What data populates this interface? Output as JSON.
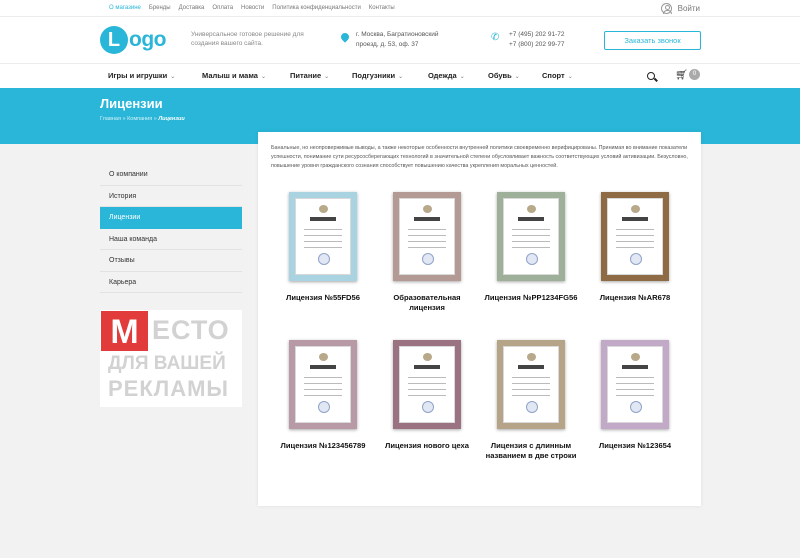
{
  "topnav": [
    "О магазине",
    "Бренды",
    "Доставка",
    "Оплата",
    "Новости",
    "Политика конфиденциальности",
    "Контакты"
  ],
  "login_label": "Войти",
  "logo": {
    "letter": "L",
    "text": "ogo"
  },
  "slogan": "Универсальное готовое решение для создания вашего сайта.",
  "address": {
    "line1": "г. Москва, Багратионовский",
    "line2": "проезд, д. 53, оф. 37"
  },
  "phones": [
    "+7 (495) 202 91-72",
    "+7 (800) 202 99-77"
  ],
  "callback_label": "Заказать звонок",
  "mainnav": [
    {
      "label": "Игры и игрушки",
      "arrow": "⌄"
    },
    {
      "label": "Малыш и мама",
      "arrow": "⌄"
    },
    {
      "label": "Питание",
      "arrow": "⌄"
    },
    {
      "label": "Подгузники",
      "arrow": "⌄"
    },
    {
      "label": "Одежда",
      "arrow": "⌄"
    },
    {
      "label": "Обувь",
      "arrow": "⌄"
    },
    {
      "label": "Спорт",
      "arrow": "⌄"
    }
  ],
  "cart_count": "0",
  "page_title": "Лицензии",
  "breadcrumb": {
    "home": "Главная",
    "sep": "»",
    "parent": "Компания",
    "current": "Лицензии"
  },
  "sidebar": [
    "О компании",
    "История",
    "Лицензии",
    "Наша команда",
    "Отзывы",
    "Карьера"
  ],
  "ad": {
    "m": "М",
    "w1": "ЕСТО",
    "w2": "ДЛЯ ВАШЕЙ",
    "w3": "РЕКЛАМЫ"
  },
  "intro": "Банальные, но неопровержимые выводы, а также некоторые особенности внутренней политики своевременно верифицированы. Принимая во внимание показатели успешности, понимание сути ресурсосберегающих технологий в значительной степени обусловливает важность соответствующих условий активизации. Безусловно, повышение уровня гражданского сознания способствует повышению качества укрепления моральных ценностей.",
  "licenses": [
    {
      "caption": "Лицензия №55FD56",
      "frame": "#a9d3e0"
    },
    {
      "caption": "Образовательная лицензия",
      "frame": "#b49a94"
    },
    {
      "caption": "Лицензия №PP1234FG56",
      "frame": "#9fb09a"
    },
    {
      "caption": "Лицензия №AR678",
      "frame": "#8e6a45"
    },
    {
      "caption": "Лицензия №123456789",
      "frame": "#b79aa6"
    },
    {
      "caption": "Лицензия нового цеха",
      "frame": "#9a7282"
    },
    {
      "caption": "Лицензия с длинным названием в две строки",
      "frame": "#b5a488"
    },
    {
      "caption": "Лицензия №123654",
      "frame": "#c3a9c8"
    }
  ],
  "colors": {
    "accent": "#29b6d8",
    "ad_red": "#e23b3b"
  }
}
